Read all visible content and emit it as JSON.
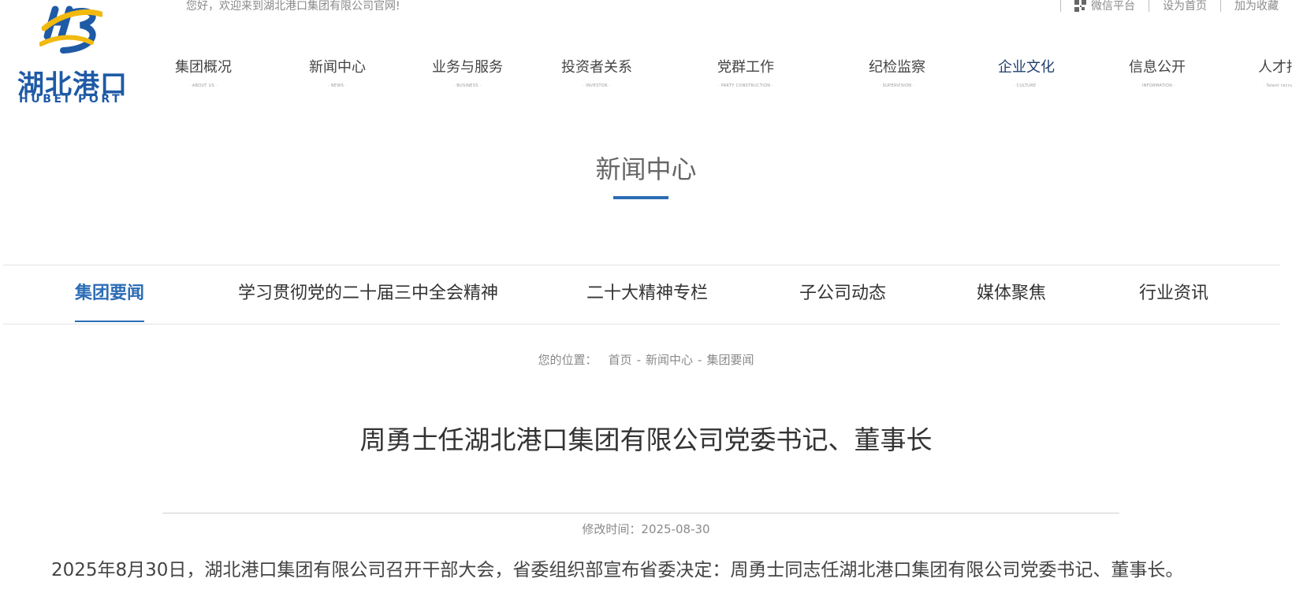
{
  "header": {
    "welcome": "您好，欢迎来到湖北港口集团有限公司官网!",
    "logo": {
      "cn": "湖北港口",
      "en": "HUBEI PORT",
      "mark": "HB",
      "colors": {
        "blue": "#1f5aa6",
        "yellow": "#f2b90f"
      }
    },
    "toplinks": [
      {
        "label": "微信平台",
        "icon": "qr-code-icon"
      },
      {
        "label": "设为首页"
      },
      {
        "label": "加为收藏"
      }
    ]
  },
  "nav": {
    "items": [
      {
        "cn": "集团概况",
        "en": "· ABOUT US ·"
      },
      {
        "cn": "新闻中心",
        "en": "· NEWS ·"
      },
      {
        "cn": "业务与服务",
        "en": "· BUSINESS ·"
      },
      {
        "cn": "投资者关系",
        "en": "· INVESTOR ·"
      },
      {
        "cn": "党群工作",
        "en": "· PARTY CONSTRUCTION ·"
      },
      {
        "cn": "纪检监察",
        "en": "· SUPERVISION ·"
      },
      {
        "cn": "企业文化",
        "en": "· CULTURE ·"
      },
      {
        "cn": "信息公开",
        "en": "· INFORMATION ·"
      },
      {
        "cn": "人才招",
        "en": "· Talent recruit"
      }
    ]
  },
  "section": {
    "title": "新闻中心",
    "accent": "#2b6cb5"
  },
  "subtabs": [
    {
      "label": "集团要闻"
    },
    {
      "label": "学习贯彻党的二十届三中全会精神"
    },
    {
      "label": "二十大精神专栏"
    },
    {
      "label": "子公司动态"
    },
    {
      "label": "媒体聚焦"
    },
    {
      "label": "行业资讯"
    }
  ],
  "breadcrumb": {
    "label": "您的位置：",
    "items": [
      "首页",
      "新闻中心",
      "集团要闻"
    ],
    "separator": "-"
  },
  "article": {
    "title": "周勇士任湖北港口集团有限公司党委书记、董事长",
    "meta": "修改时间：2025-08-30",
    "body": "2025年8月30日，湖北港口集团有限公司召开干部大会，省委组织部宣布省委决定：周勇士同志任湖北港口集团有限公司党委书记、董事长。"
  }
}
